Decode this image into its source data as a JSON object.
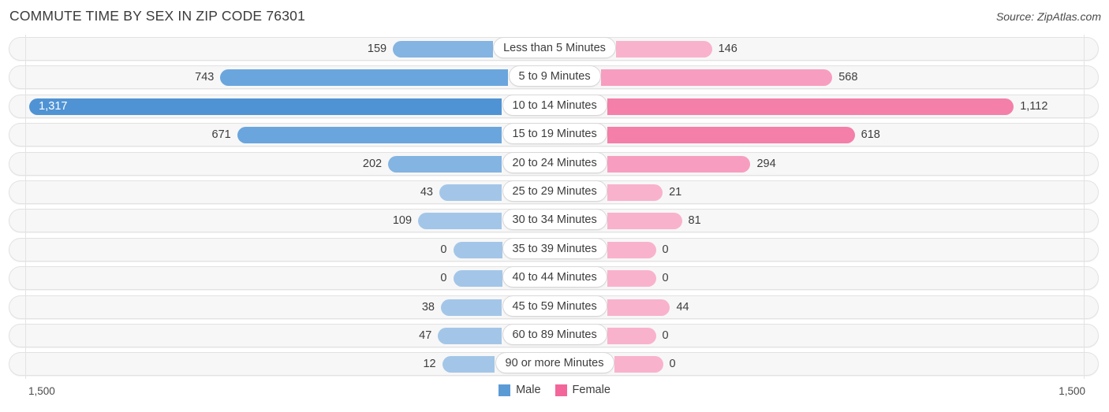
{
  "header": {
    "title": "COMMUTE TIME BY SEX IN ZIP CODE 76301",
    "source": "Source: ZipAtlas.com"
  },
  "axis": {
    "left_label": "1,500",
    "right_label": "1,500"
  },
  "legend": {
    "items": [
      {
        "label": "Male",
        "color": "#5b9bd5"
      },
      {
        "label": "Female",
        "color": "#f2669a"
      }
    ]
  },
  "colors": {
    "male_light": "#a3c6e8",
    "male_mid": "#83b4e2",
    "male_strong": "#6aa6dd",
    "male_max": "#4f93d4",
    "female_light": "#f9b2cc",
    "female_mid": "#f79ec0",
    "female_strong": "#f47fa8",
    "female_max": "#f05b90",
    "track": "#f7f7f7",
    "gridline": "#e3e3e3"
  },
  "chart_data": {
    "type": "bar",
    "subtype": "diverging-bidirectional",
    "title": "COMMUTE TIME BY SEX IN ZIP CODE 76301",
    "xlabel": "",
    "ylabel": "",
    "xlim": [
      1500,
      1500
    ],
    "axis_left_max": 1500,
    "axis_right_max": 1500,
    "grid": true,
    "legend_position": "bottom-center",
    "categories": [
      "Less than 5 Minutes",
      "5 to 9 Minutes",
      "10 to 14 Minutes",
      "15 to 19 Minutes",
      "20 to 24 Minutes",
      "25 to 29 Minutes",
      "30 to 34 Minutes",
      "35 to 39 Minutes",
      "40 to 44 Minutes",
      "45 to 59 Minutes",
      "60 to 89 Minutes",
      "90 or more Minutes"
    ],
    "series": [
      {
        "name": "Male",
        "direction": "left",
        "values": [
          159,
          743,
          1317,
          671,
          202,
          43,
          109,
          0,
          0,
          38,
          47,
          12
        ],
        "labels": [
          "159",
          "743",
          "1,317",
          "671",
          "202",
          "43",
          "109",
          "0",
          "0",
          "38",
          "47",
          "12"
        ]
      },
      {
        "name": "Female",
        "direction": "right",
        "values": [
          146,
          568,
          1112,
          618,
          294,
          21,
          81,
          0,
          0,
          44,
          0,
          0
        ],
        "labels": [
          "146",
          "568",
          "1,112",
          "618",
          "294",
          "21",
          "81",
          "0",
          "0",
          "44",
          "0",
          "0"
        ]
      }
    ]
  }
}
